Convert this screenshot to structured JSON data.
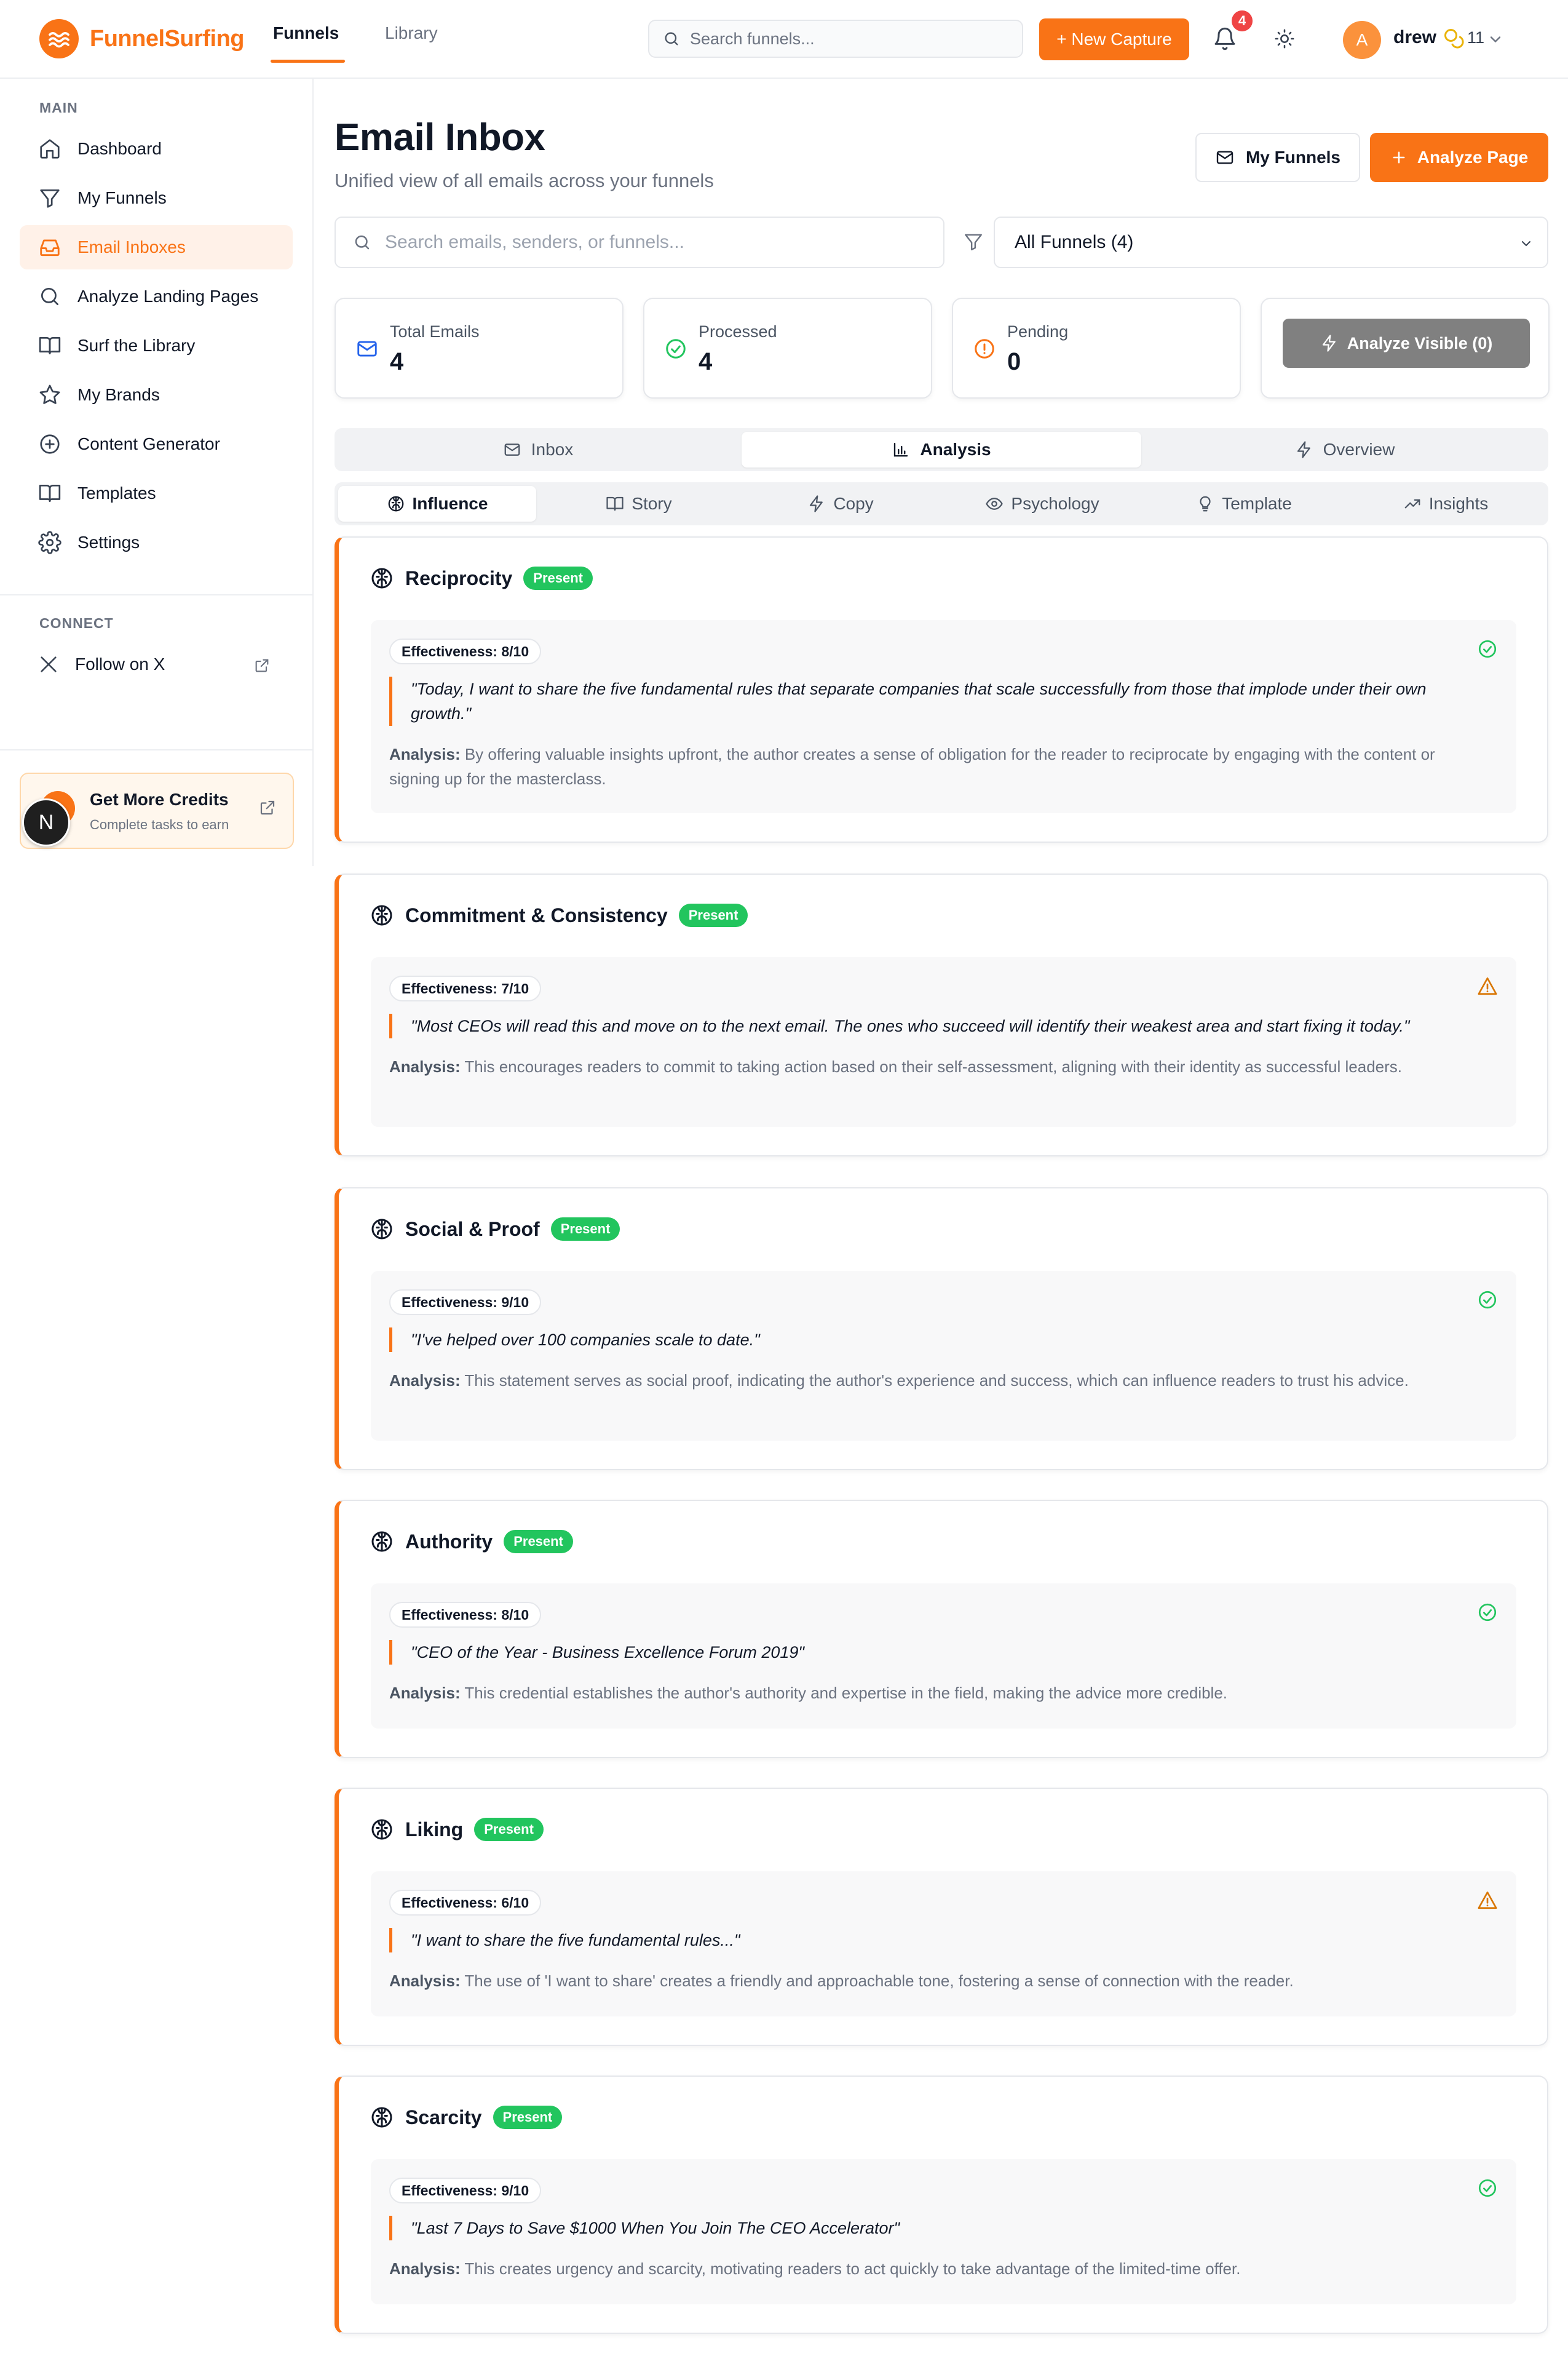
{
  "app": {
    "brand": "FunnelSurfing",
    "nav_tabs": [
      {
        "label": "Funnels"
      },
      {
        "label": "Library"
      }
    ],
    "search_placeholder": "Search funnels...",
    "new_capture_label": "+ New Capture",
    "notification_count": "4",
    "user": {
      "initial": "A",
      "name": "drew",
      "credits": "11"
    }
  },
  "sidebar": {
    "main_heading": "MAIN",
    "items": [
      {
        "label": "Dashboard",
        "icon": "home-icon"
      },
      {
        "label": "My Funnels",
        "icon": "funnel-icon"
      },
      {
        "label": "Email Inboxes",
        "icon": "inbox-icon"
      },
      {
        "label": "Analyze Landing Pages",
        "icon": "search-icon"
      },
      {
        "label": "Surf the Library",
        "icon": "book-open-icon"
      },
      {
        "label": "My Brands",
        "icon": "star-icon"
      },
      {
        "label": "Content Generator",
        "icon": "plus-circle-icon"
      },
      {
        "label": "Templates",
        "icon": "book-icon"
      },
      {
        "label": "Settings",
        "icon": "gear-icon"
      }
    ],
    "connect_heading": "CONNECT",
    "follow_label": "Follow on X",
    "credits_title": "Get More Credits",
    "credits_sub": "Complete tasks to earn",
    "floating_avatar": "N"
  },
  "main": {
    "title": "Email Inbox",
    "subtitle": "Unified view of all emails across your funnels",
    "my_funnels_label": "My Funnels",
    "analyze_page_label": "Analyze Page",
    "search_placeholder": "Search emails, senders, or funnels...",
    "funnel_filter": "All Funnels (4)",
    "stats": [
      {
        "label": "Total Emails",
        "value": "4"
      },
      {
        "label": "Processed",
        "value": "4"
      },
      {
        "label": "Pending",
        "value": "0"
      }
    ],
    "analyze_visible_label": "Analyze Visible (0)",
    "tabs": [
      {
        "label": "Inbox"
      },
      {
        "label": "Analysis"
      },
      {
        "label": "Overview"
      }
    ],
    "subtabs": [
      {
        "label": "Influence"
      },
      {
        "label": "Story"
      },
      {
        "label": "Copy"
      },
      {
        "label": "Psychology"
      },
      {
        "label": "Template"
      },
      {
        "label": "Insights"
      }
    ],
    "analysis_prefix": "Analysis:",
    "principles": [
      {
        "name": "Reciprocity",
        "badge": "Present",
        "effectiveness": "Effectiveness: 8/10",
        "status": "check",
        "quote": "\"Today, I want to share the five fundamental rules that separate companies that scale successfully from those that implode under their own growth.\"",
        "analysis": "By offering valuable insights upfront, the author creates a sense of obligation for the reader to reciprocate by engaging with the content or signing up for the masterclass."
      },
      {
        "name": "Commitment & Consistency",
        "badge": "Present",
        "effectiveness": "Effectiveness: 7/10",
        "status": "warning",
        "quote": "\"Most CEOs will read this and move on to the next email. The ones who succeed will identify their weakest area and start fixing it today.\"",
        "analysis": "This encourages readers to commit to taking action based on their self-assessment, aligning with their identity as successful leaders."
      },
      {
        "name": "Social & Proof",
        "badge": "Present",
        "effectiveness": "Effectiveness: 9/10",
        "status": "check",
        "quote": "\"I've helped over 100 companies scale to date.\"",
        "analysis": "This statement serves as social proof, indicating the author's experience and success, which can influence readers to trust his advice."
      },
      {
        "name": "Authority",
        "badge": "Present",
        "effectiveness": "Effectiveness: 8/10",
        "status": "check",
        "quote": "\"CEO of the Year - Business Excellence Forum 2019\"",
        "analysis": "This credential establishes the author's authority and expertise in the field, making the advice more credible."
      },
      {
        "name": "Liking",
        "badge": "Present",
        "effectiveness": "Effectiveness: 6/10",
        "status": "warning",
        "quote": "\"I want to share the five fundamental rules...\"",
        "analysis": "The use of 'I want to share' creates a friendly and approachable tone, fostering a sense of connection with the reader."
      },
      {
        "name": "Scarcity",
        "badge": "Present",
        "effectiveness": "Effectiveness: 9/10",
        "status": "check",
        "quote": "\"Last 7 Days to Save $1000 When You Join The CEO Accelerator\"",
        "analysis": "This creates urgency and scarcity, motivating readers to act quickly to take advantage of the limited-time offer."
      }
    ]
  },
  "colors": {
    "accent": "#f97316",
    "success": "#22c55e",
    "warning": "#d97706",
    "danger": "#ef4444"
  }
}
